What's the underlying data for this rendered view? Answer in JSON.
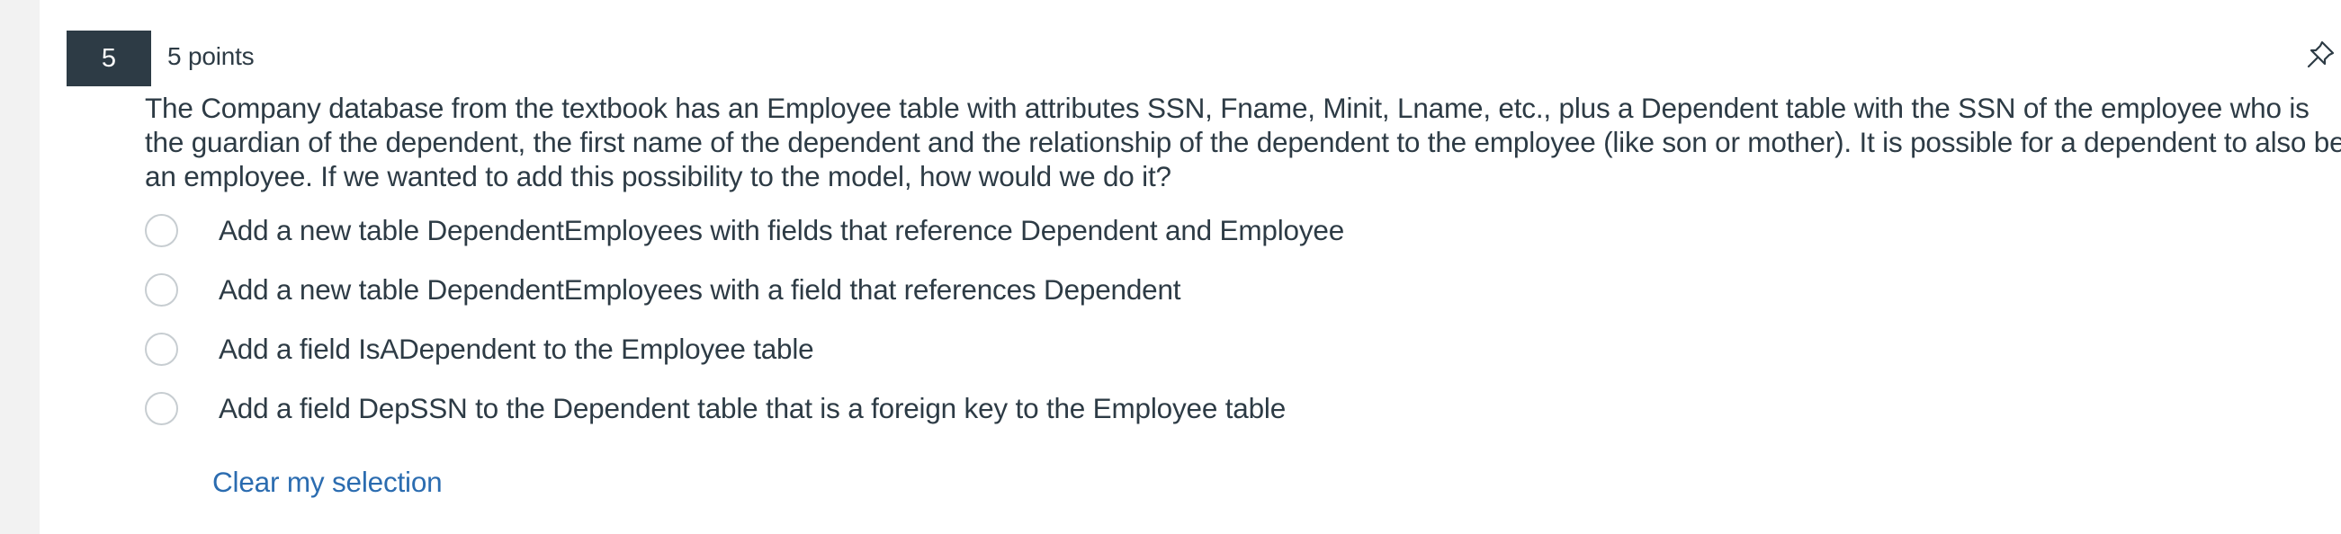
{
  "question": {
    "number": "5",
    "points": "5 points",
    "text": "The Company database from the textbook has an Employee table with attributes SSN, Fname, Minit, Lname, etc., plus a Dependent table with the SSN of the employee who is the guardian of the dependent, the first name of the dependent and the relationship of the dependent to the employee (like son or mother). It is possible for a dependent to also be an employee. If we wanted to add this possibility to the model, how would we do it?",
    "pin_icon": "pin-icon"
  },
  "options": [
    {
      "label": "Add a new table DependentEmployees with fields that reference Dependent and Employee",
      "selected": false
    },
    {
      "label": "Add a new table DependentEmployees with a field that references Dependent",
      "selected": false
    },
    {
      "label": "Add a field IsADependent to the Employee table",
      "selected": false
    },
    {
      "label": "Add a field DepSSN to the Dependent table that is a foreign key to the Employee table",
      "selected": false
    }
  ],
  "clear_selection": "Clear my selection",
  "colors": {
    "badge_bg": "#2d3b45",
    "text": "#2d3b45",
    "link": "#2b6cb0",
    "radio_border": "#c7cdd1"
  }
}
